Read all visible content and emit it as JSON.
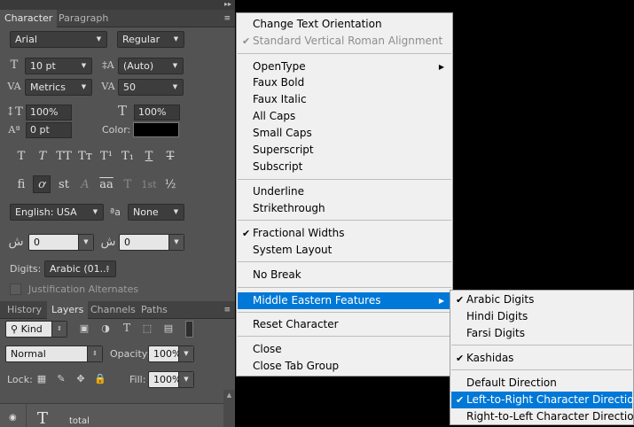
{
  "panel": {
    "collapse_glyph": "▸▸",
    "tabs": {
      "character": "Character",
      "paragraph": "Paragraph"
    },
    "menu_glyph": "≡",
    "font_family": "Arial",
    "font_style": "Regular",
    "font_size": "10 pt",
    "leading": "(Auto)",
    "kerning": "Metrics",
    "tracking": "50",
    "vertical_scale": "100%",
    "horizontal_scale": "100%",
    "baseline_shift": "0 pt",
    "color_label": "Color:",
    "color_value": "#000000",
    "type_buttons": [
      "T",
      "T",
      "TT",
      "Tт",
      "T¹",
      "T₁",
      "T",
      "T"
    ],
    "opentype_buttons": [
      "fi",
      "ơ",
      "st",
      "A",
      "aa",
      "T",
      "1st",
      "½"
    ],
    "language": "English: USA",
    "aa_glyph": "ªa",
    "anti_alias": "None",
    "me_field_1": "0",
    "me_field_2": "0",
    "digits_label": "Digits:",
    "digits_value": "Arabic (01...",
    "justification_alternates": "Justification Alternates"
  },
  "layers_panel": {
    "tabs": {
      "history": "History",
      "layers": "Layers",
      "channels": "Channels",
      "paths": "Paths"
    },
    "filter_kind": "Kind",
    "blend_mode": "Normal",
    "opacity_label": "Opacity:",
    "opacity_value": "100%",
    "lock_label": "Lock:",
    "fill_label": "Fill:",
    "fill_value": "100%",
    "layer_name": "total"
  },
  "menu": {
    "items": {
      "change_text_orientation": "Change Text Orientation",
      "standard_vertical_roman": "Standard Vertical Roman Alignment",
      "opentype": "OpenType",
      "faux_bold": "Faux Bold",
      "faux_italic": "Faux Italic",
      "all_caps": "All Caps",
      "small_caps": "Small Caps",
      "superscript": "Superscript",
      "subscript": "Subscript",
      "underline": "Underline",
      "strikethrough": "Strikethrough",
      "fractional_widths": "Fractional Widths",
      "system_layout": "System Layout",
      "no_break": "No Break",
      "middle_eastern_features": "Middle Eastern Features",
      "reset_character": "Reset Character",
      "close": "Close",
      "close_tab_group": "Close Tab Group"
    }
  },
  "submenu": {
    "items": {
      "arabic_digits": "Arabic Digits",
      "hindi_digits": "Hindi Digits",
      "farsi_digits": "Farsi Digits",
      "kashidas": "Kashidas",
      "default_direction": "Default Direction",
      "ltr_direction": "Left-to-Right Character Direction",
      "rtl_direction": "Right-to-Left Character Direction"
    }
  },
  "glyphs": {
    "check": "✔",
    "submenu_arrow": "▶",
    "dropdown_arrow": "▼"
  },
  "colors": {
    "highlight": "#0078d7",
    "menu_bg": "#f0f0f0",
    "panel_bg": "#535353"
  }
}
